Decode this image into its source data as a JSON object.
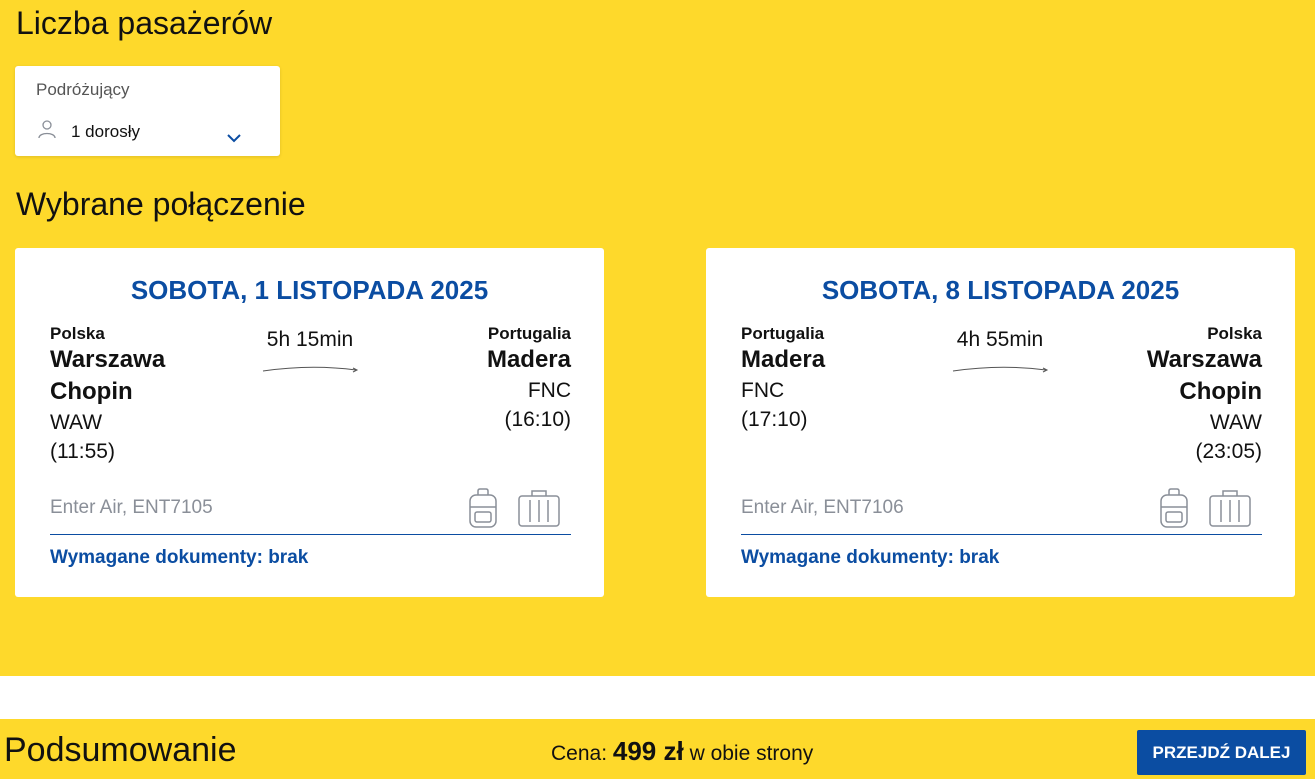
{
  "passengers": {
    "title": "Liczba pasażerów",
    "label": "Podróżujący",
    "value": "1 dorosły",
    "person_icon": "person-icon",
    "dropdown_icon": "chevron-down-icon"
  },
  "connection": {
    "title": "Wybrane połączenie",
    "outbound": {
      "date": "SOBOTA, 1 LISTOPADA 2025",
      "duration": "5h 15min",
      "from": {
        "country": "Polska",
        "city": "Warszawa Chopin",
        "code": "WAW",
        "time": "(11:55)"
      },
      "to": {
        "country": "Portugalia",
        "city": "Madera",
        "code": "FNC",
        "time": "(16:10)"
      },
      "flight": "Enter Air, ENT7105",
      "documents": "Wymagane dokumenty: brak"
    },
    "return": {
      "date": "SOBOTA, 8 LISTOPADA 2025",
      "duration": "4h 55min",
      "from": {
        "country": "Portugalia",
        "city": "Madera",
        "code": "FNC",
        "time": "(17:10)"
      },
      "to": {
        "country": "Polska",
        "city": "Warszawa Chopin",
        "code": "WAW",
        "time": "(23:05)"
      },
      "flight": "Enter Air, ENT7106",
      "documents": "Wymagane dokumenty: brak"
    }
  },
  "summary": {
    "title": "Podsumowanie",
    "price_label": "Cena:",
    "price_value": "499 zł",
    "price_suffix": "w obie strony",
    "next_label": "PRZEJDŹ DALEJ"
  },
  "colors": {
    "background": "#fed92b",
    "accent": "#0b4da2",
    "muted": "#8a8f98"
  }
}
